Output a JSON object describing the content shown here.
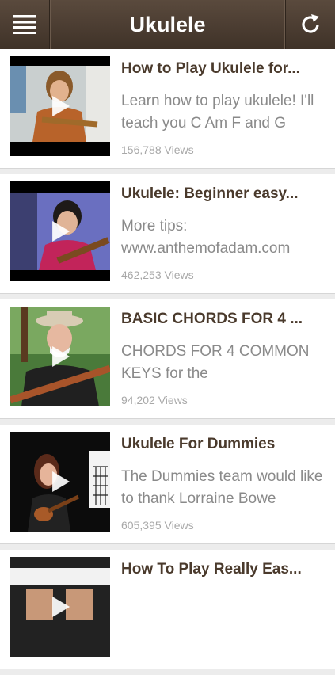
{
  "header": {
    "title": "Ukulele",
    "menu_icon": "hamburger-menu-icon",
    "refresh_icon": "refresh-icon"
  },
  "videos": [
    {
      "title": "How to Play Ukulele for...",
      "description": "Learn how to play ukulele! I'll teach you C Am F and G",
      "views": "156,788 Views"
    },
    {
      "title": "Ukulele: Beginner easy...",
      "description": "More tips: www.anthemofadam.com",
      "views": "462,253 Views"
    },
    {
      "title": "BASIC CHORDS FOR 4 ...",
      "description": "CHORDS FOR 4 COMMON KEYS for the",
      "views": "94,202 Views"
    },
    {
      "title": "Ukulele For Dummies",
      "description": "The Dummies team would like to thank Lorraine Bowe",
      "views": "605,395 Views"
    },
    {
      "title": "How To Play Really Eas...",
      "description": "",
      "views": ""
    }
  ],
  "colors": {
    "header": "#4b3c30",
    "title_text": "#4a3a2c",
    "desc_text": "#8a8a8a"
  }
}
